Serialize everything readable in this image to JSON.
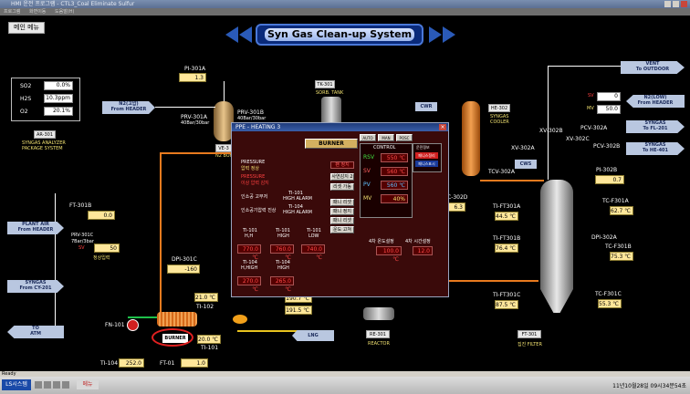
{
  "window": {
    "title": "HMI 운전 프로그램 - CTL3_Coal Eliminate Sulfur"
  },
  "menubar": {
    "items": [
      "프로그램",
      "화면이동",
      "도움말(H)"
    ]
  },
  "main_menu_button": "메인 메뉴",
  "page_title": "Syn Gas Clean-up System",
  "analyzer": {
    "rows": [
      {
        "label": "SO2",
        "value": "0.0%"
      },
      {
        "label": "H2S",
        "value": "10.3ppm"
      },
      {
        "label": "O2",
        "value": "20.1%"
      }
    ],
    "tag": "AR-301",
    "caption_line1": "SYNGAS ANALYZER",
    "caption_line2": "PACKAGE SYSTEM"
  },
  "left_panel": {
    "pi301a_label": "PI-301A",
    "pi301a_value": "1.3 kg/cm²",
    "n2_header": "N2(고압)\nFrom HEADER",
    "prv301a_label": "PRV-301A",
    "prv301a_sub": "40Bar/30bar",
    "prv301b_label": "PRV-301B",
    "prv301b_sub": "40Bar/30bar",
    "ve_label": "VE-3",
    "n2_buffer": "N2 BUFF TANK",
    "ft301b_label": "FT-301B",
    "ft301b_value": "0.0 Nm³/h",
    "plant_air": "PLANT AIR\nFrom HEADER",
    "prv_small_label": "PRV-301C",
    "prv_small_sub": "7Bar/3bar",
    "sv_label": "SV",
    "sv_value": "50 Nm³/h",
    "normal_in": "정상입력",
    "syngas_from": "SYNGAS\nFrom CY-201",
    "dpi301c_label": "DPI-301C",
    "dpi301c_value": "-160 mmH2O",
    "to_atm": "TO\nATM",
    "fn101_label": "FN-101",
    "burner_label": "BURNER",
    "ti101_label": "TI-101",
    "ti102_label": "TI-102",
    "ti102_value": "21.0 ℃",
    "ti101_value": "20.0 ℃",
    "ti104_label": "TI-104",
    "ti104_value": "252.0 ℃",
    "ft01_label": "FT-01",
    "ft01_value": "1.0 Nm³/h",
    "lng_label": "LNG"
  },
  "center": {
    "tk301": "TK-301",
    "sorb_tank": "SORB. TANK",
    "re301_tag": "RE-301",
    "reactor": "REACTOR",
    "te_value1": "190.7 ℃",
    "te_value2": "191.5 ℃"
  },
  "right_panel": {
    "vent": "VENT\nTo OUTDOOR",
    "n2_low": "N2(LOW)\nFrom HEADER",
    "syngas_fl": "SYNGAS\nTo FL-201",
    "syngas_he": "SYNGAS\nTo HE-401",
    "sv_label": "SV",
    "sv_value": "0",
    "mv_label": "MV",
    "mv_value": "50.0",
    "cwr": "CWR",
    "cws": "CWS",
    "he302_tag": "HE-302",
    "cooler_l1": "SYNGAS",
    "cooler_l2": "COOLER",
    "tcv302a": "TCV-302A",
    "xv302a": "XV-302A",
    "xv302b": "XV-302B",
    "xv302c": "XV-302C",
    "pcv302a": "PCV-302A",
    "pcv302b": "PCV-302B",
    "pi302b_label": "PI-302B",
    "pi302b_value": "0.7 kg/cm²",
    "c302d": "C-302D",
    "c302d_value": "6.3 ℃",
    "tift301a_label": "TI-FT301A",
    "tift301a_value": "44.5 ℃",
    "tcf301a_label": "TC-F301A",
    "tcf301a_value": "62.7 ℃",
    "dpi302a_label": "DPI-302A",
    "tift301b_label": "TI-FT301B",
    "tift301b_value": "76.4 ℃",
    "tcf301b_label": "TC-F301B",
    "tcf301b_value": "75.3 ℃",
    "tift301c_label": "TI-FT301C",
    "tift301c_value": "87.5 ℃",
    "tcf301c_label": "TC-F301C",
    "tcf301c_value": "55.3 ℃",
    "ft301_tag": "FT-301",
    "filter": "집진 FILTER"
  },
  "popup": {
    "title": "PPE - HEATING 3",
    "burner_btn": "BURNER",
    "pressure_l1": "PRESSURE",
    "pressure_l2": "압력 정상",
    "fuel_l1": "PRESSURE",
    "fuel_l2": "이상 압력 감지",
    "fan_btn": "팬 정지",
    "ignite_btn": "사연감지 2",
    "reset_btn": "리셋 가동",
    "ti101_hh_l1": "TI-101",
    "ti101_hh_l2": "HIGH ALARM",
    "ti104_h_l1": "TI-104",
    "ti104_h_l2": "HIGH ALARM",
    "hi_temp": "인소공 고부저",
    "hi_temp2": "인소공기압력 진상",
    "reset1": "패니 리셋",
    "reset2": "패니 정지",
    "reset3": "패니 리셋",
    "fan_off": "운도 고쳐",
    "tabs": [
      "AUTO",
      "MAN",
      "POSC"
    ],
    "control_title": "CONTROL",
    "ctl_rows": [
      {
        "label": "RSV",
        "value": "550 ℃"
      },
      {
        "label": "SV",
        "value": "560 ℃"
      },
      {
        "label": "PV",
        "value": "560 ℃"
      },
      {
        "label": "MV",
        "value": "40%"
      }
    ],
    "side_title": "운전정보",
    "side_btn1": "패니스정리",
    "side_btn2": "패니스표시",
    "temp_grid": [
      {
        "l1": "TI-101",
        "l2": "H,H",
        "value": "770.0 ℃"
      },
      {
        "l1": "TI-101",
        "l2": "HIGH",
        "value": "760.0 ℃"
      },
      {
        "l1": "TI-101",
        "l2": "LOW",
        "value": "740.0 ℃"
      },
      {
        "l1": "TI-104",
        "l2": "H,HIGH",
        "value": "270.0 ℃"
      },
      {
        "l1": "TI-104",
        "l2": "HIGH",
        "value": "265.0 ℃"
      }
    ],
    "cur_temp_label": "4차 온도설정",
    "cur_temp_value": "100.0 ℃",
    "cur_time_label": "4차 시간설정",
    "cur_time_value": "12.0"
  },
  "status": {
    "text": "Ready"
  },
  "taskbar": {
    "logo": "LS시스템",
    "menu": "메뉴",
    "datetime": "11년10월28일   09시34분54초"
  }
}
